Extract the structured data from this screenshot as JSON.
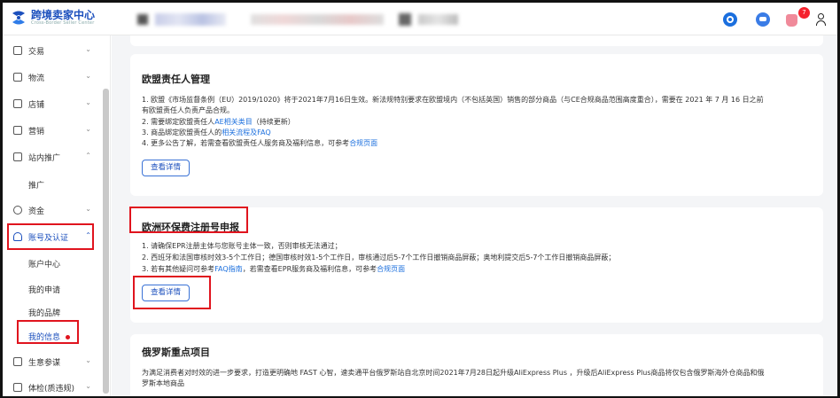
{
  "header": {
    "logo_title": "跨境卖家中心",
    "logo_subtitle": "Cross-Border Seller Center",
    "notification_count": "7"
  },
  "sidebar": {
    "items": [
      {
        "label": "交易"
      },
      {
        "label": "物流"
      },
      {
        "label": "店铺"
      },
      {
        "label": "营销"
      },
      {
        "label": "站内推广"
      },
      {
        "label": "推广"
      },
      {
        "label": "资金"
      },
      {
        "label": "账号及认证"
      },
      {
        "label": "账户中心"
      },
      {
        "label": "我的申请"
      },
      {
        "label": "我的品牌"
      },
      {
        "label": "我的信息"
      },
      {
        "label": "生意参谋"
      },
      {
        "label": "体检(质违规)"
      }
    ]
  },
  "cards": {
    "eu": {
      "title": "欧盟责任人管理",
      "line1": "1. 欧盟《市场监督条例（EU）2019/1020》将于2021年7月16日生效。新法规特别要求在欧盟境内（不包括英国）销售的部分商品（与CE合规商品范围高度重合），需要在 2021 年 7 月 16 日之前",
      "line1b": "有欧盟责任人负责产品合规。",
      "line2a": "2. 需要绑定欧盟责任人",
      "line2link": "AE相关类目",
      "line2b": "（持续更新）",
      "line3a": "3. 商品绑定欧盟责任人的",
      "line3link": "相关流程及FAQ",
      "line4a": "4. 更多公告了解，若需查看欧盟责任人服务商及福利信息，可参考",
      "line4link": "合规页面",
      "button": "查看详情"
    },
    "epr": {
      "title": "欧洲环保费注册号申报",
      "line1": "1. 请确保EPR注册主体与您账号主体一致，否则审核无法通过；",
      "line2": "2. 西班牙和法国审核时效3-5个工作日；德国审核时效1-5个工作日，审核通过后5-7个工作日撤销商品屏蔽；奥地利提交后5-7个工作日撤销商品屏蔽；",
      "line3a": "3. 若有其他疑问可参考",
      "line3link1": "FAQ指南",
      "line3b": "，若需查看EPR服务商及福利信息，可参考",
      "line3link2": "合规页面",
      "button": "查看详情"
    },
    "ru": {
      "title": "俄罗斯重点项目",
      "line1": "为满足消费者对时效的进一步要求，打造更明确地 FAST 心智，速卖通平台俄罗斯站自北京时间2021年7月28日起升级AliExpress Plus ，升级后AliExpress Plus商品将仅包含俄罗斯海外仓商品和俄",
      "line1b": "罗斯本地商品"
    }
  },
  "colors": {
    "brand": "#1b4fbd",
    "link": "#1b6fde",
    "highlight_box": "#e0141e",
    "badge": "#f5222d"
  }
}
